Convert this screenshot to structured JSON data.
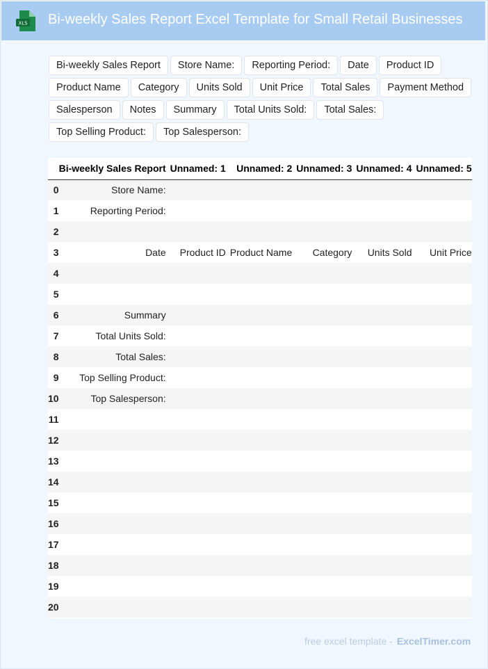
{
  "header": {
    "title": "Bi-weekly Sales Report Excel Template for Small Retail Businesses",
    "icon_label": "XLS",
    "icon_color": "#1e8a4c"
  },
  "tags": [
    "Bi-weekly Sales Report",
    "Store Name:",
    "Reporting Period:",
    "Date",
    "Product ID",
    "Product Name",
    "Category",
    "Units Sold",
    "Unit Price",
    "Total Sales",
    "Payment Method",
    "Salesperson",
    "Notes",
    "Summary",
    "Total Units Sold:",
    "Total Sales:",
    "Top Selling Product:",
    "Top Salesperson:"
  ],
  "table": {
    "columns": [
      "",
      "Bi-weekly Sales Report",
      "Unnamed: 1",
      "Unnamed: 2",
      "Unnamed: 3",
      "Unnamed: 4",
      "Unnamed: 5"
    ],
    "rows": [
      [
        "0",
        "Store Name:",
        "",
        "",
        "",
        "",
        ""
      ],
      [
        "1",
        "Reporting Period:",
        "",
        "",
        "",
        "",
        ""
      ],
      [
        "2",
        "",
        "",
        "",
        "",
        "",
        ""
      ],
      [
        "3",
        "Date",
        "Product ID",
        "Product Name",
        "Category",
        "Units Sold",
        "Unit Price"
      ],
      [
        "4",
        "",
        "",
        "",
        "",
        "",
        ""
      ],
      [
        "5",
        "",
        "",
        "",
        "",
        "",
        ""
      ],
      [
        "6",
        "Summary",
        "",
        "",
        "",
        "",
        ""
      ],
      [
        "7",
        "Total Units Sold:",
        "",
        "",
        "",
        "",
        ""
      ],
      [
        "8",
        "Total Sales:",
        "",
        "",
        "",
        "",
        ""
      ],
      [
        "9",
        "Top Selling Product:",
        "",
        "",
        "",
        "",
        ""
      ],
      [
        "10",
        "Top Salesperson:",
        "",
        "",
        "",
        "",
        ""
      ],
      [
        "11",
        "",
        "",
        "",
        "",
        "",
        ""
      ],
      [
        "12",
        "",
        "",
        "",
        "",
        "",
        ""
      ],
      [
        "13",
        "",
        "",
        "",
        "",
        "",
        ""
      ],
      [
        "14",
        "",
        "",
        "",
        "",
        "",
        ""
      ],
      [
        "15",
        "",
        "",
        "",
        "",
        "",
        ""
      ],
      [
        "16",
        "",
        "",
        "",
        "",
        "",
        ""
      ],
      [
        "17",
        "",
        "",
        "",
        "",
        "",
        ""
      ],
      [
        "18",
        "",
        "",
        "",
        "",
        "",
        ""
      ],
      [
        "19",
        "",
        "",
        "",
        "",
        "",
        ""
      ],
      [
        "20",
        "",
        "",
        "",
        "",
        "",
        ""
      ]
    ]
  },
  "footer": {
    "text": "free excel template -",
    "brand": "ExcelTimer.com"
  }
}
